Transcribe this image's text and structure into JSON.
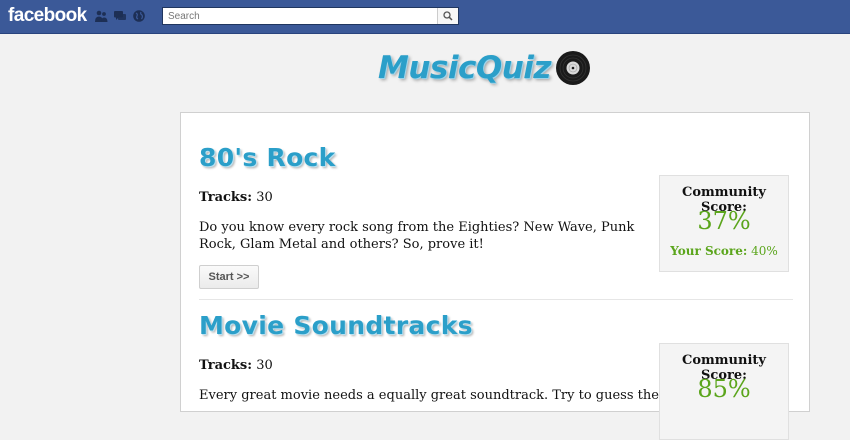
{
  "topbar": {
    "logo": "facebook",
    "search_placeholder": "Search",
    "icons": [
      "friends-icon",
      "messages-icon",
      "notifications-globe-icon"
    ]
  },
  "app": {
    "title": "MusicQuiz",
    "logo_icon": "vinyl-record-icon"
  },
  "quizzes": [
    {
      "title": "80's Rock",
      "tracks_label": "Tracks:",
      "tracks_value": "30",
      "description": "Do you know every rock song from the Eighties? New Wave, Punk Rock, Glam Metal and others? So, prove it!",
      "start_label": "Start >>",
      "community_label": "Community Score:",
      "community_score": "37%",
      "your_score_label": "Your Score:",
      "your_score": "40%"
    },
    {
      "title": "Movie Soundtracks",
      "tracks_label": "Tracks:",
      "tracks_value": "30",
      "description": "Every great movie needs a equally great soundtrack. Try to guess these classic movie",
      "community_label": "Community Score:",
      "community_score": "85%"
    }
  ],
  "colors": {
    "facebook_blue": "#3b5998",
    "title_blue": "#2b9fc9",
    "score_green": "#5ba51c"
  }
}
